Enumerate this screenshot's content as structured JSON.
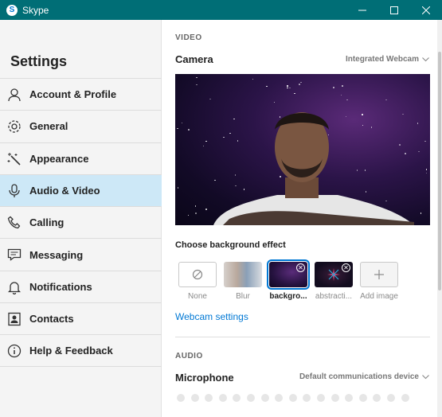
{
  "window": {
    "title": "Skype",
    "logo_letter": "S",
    "controls": [
      "minimize-icon",
      "maximize-icon",
      "close-icon"
    ]
  },
  "sidebar": {
    "heading": "Settings",
    "items": [
      {
        "label": "Account & Profile",
        "icon": "person-icon",
        "active": false
      },
      {
        "label": "General",
        "icon": "gear-icon",
        "active": false
      },
      {
        "label": "Appearance",
        "icon": "magic-wand-icon",
        "active": false
      },
      {
        "label": "Audio & Video",
        "icon": "microphone-icon",
        "active": true
      },
      {
        "label": "Calling",
        "icon": "phone-icon",
        "active": false
      },
      {
        "label": "Messaging",
        "icon": "chat-icon",
        "active": false
      },
      {
        "label": "Notifications",
        "icon": "bell-icon",
        "active": false
      },
      {
        "label": "Contacts",
        "icon": "contact-card-icon",
        "active": false
      },
      {
        "label": "Help & Feedback",
        "icon": "info-icon",
        "active": false
      }
    ]
  },
  "video": {
    "section": "VIDEO",
    "camera_label": "Camera",
    "camera_device": "Integrated Webcam",
    "background_title": "Choose background effect",
    "effects": [
      {
        "label": "None",
        "selected": false
      },
      {
        "label": "Blur",
        "selected": false
      },
      {
        "label": "backgro...",
        "selected": true
      },
      {
        "label": "abstracti...",
        "selected": false
      },
      {
        "label": "Add image",
        "selected": false
      }
    ],
    "webcam_settings": "Webcam settings"
  },
  "audio": {
    "section": "AUDIO",
    "microphone_label": "Microphone",
    "microphone_device": "Default communications device",
    "level_dots": 17
  },
  "colors": {
    "titlebar": "#006e76",
    "accent": "#0078d4",
    "active_nav": "#cde8f7"
  }
}
